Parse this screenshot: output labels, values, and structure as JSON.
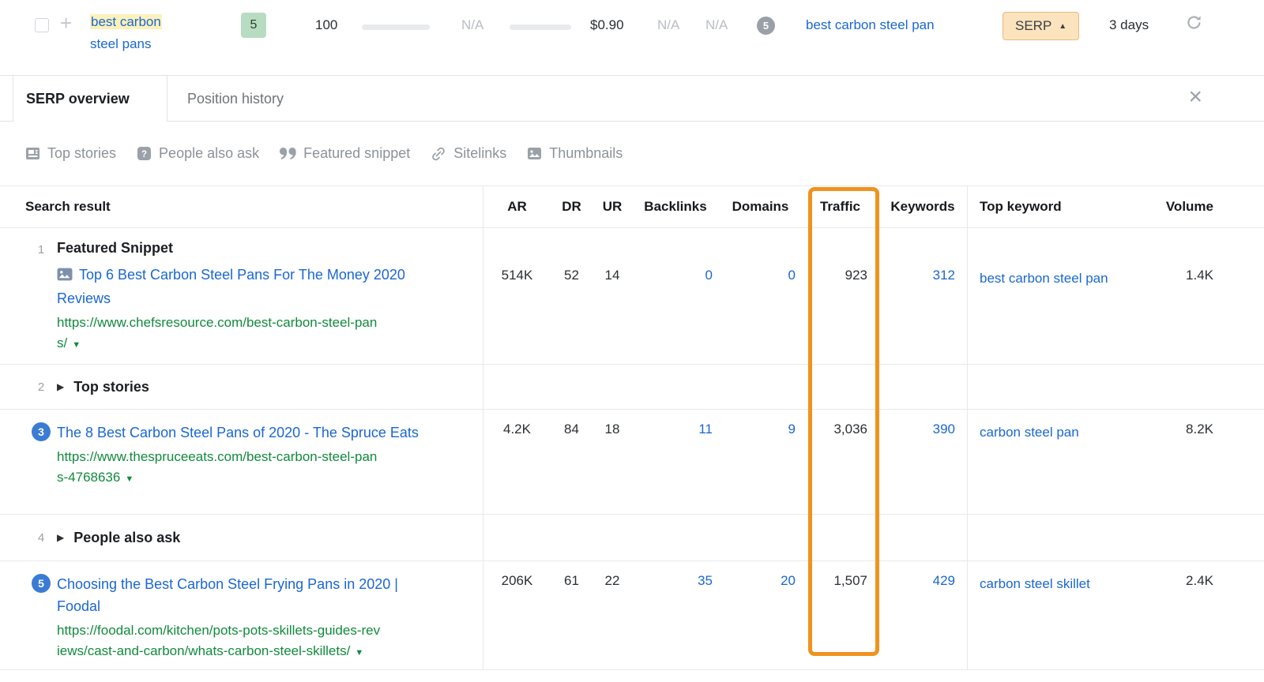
{
  "colors": {
    "link_blue": "#1a67d2",
    "url_green": "#118a3c",
    "hl_orange": "#f0921e",
    "kw_hl": "#fcf1bb",
    "kd_bg": "#b8dcc2",
    "kd_text": "#26402e",
    "serp_bg": "#fbe3bd",
    "serp_border": "#e9ba80",
    "gray_circle": "#99a0a7",
    "pos_blue": "#3a7cd5"
  },
  "glyphs": {
    "plus": "+",
    "close": "×",
    "caret_up": "▲",
    "caret_down": "▼",
    "expand_caret": "▶"
  },
  "keyword_row": {
    "keyword_highlight": "best carbon",
    "keyword_rest": " steel pans",
    "kd": "5",
    "volume": "100",
    "na1": "N/A",
    "cpc": "$0.90",
    "na2": "N/A",
    "na3": "N/A",
    "serp_features_count": "5",
    "top_keyword": "best carbon steel pan",
    "serp_button_label": "SERP",
    "updated": "3 days"
  },
  "panel": {
    "tabs": [
      {
        "label": "SERP overview"
      },
      {
        "label": "Position history"
      }
    ],
    "filters": [
      {
        "label": "Top stories",
        "icon": "top-stories-icon"
      },
      {
        "label": "People also ask",
        "icon": "people-also-ask-icon"
      },
      {
        "label": "Featured snippet",
        "icon": "featured-snippet-icon"
      },
      {
        "label": "Sitelinks",
        "icon": "sitelinks-icon"
      },
      {
        "label": "Thumbnails",
        "icon": "thumbnails-icon"
      }
    ]
  },
  "table": {
    "columns": [
      "Search result",
      "AR",
      "DR",
      "UR",
      "Backlinks",
      "Domains",
      "Traffic",
      "Keywords",
      "Top keyword",
      "Volume"
    ],
    "rows": [
      {
        "pos": "1",
        "section": "Featured Snippet",
        "title": "Top 6 Best Carbon Steel Pans For The Money 2020 Reviews",
        "url": "https://www.chefsresource.com/best-carbon-steel-pans/",
        "ar": "514K",
        "dr": "52",
        "ur": "14",
        "backlinks": "0",
        "domains": "0",
        "traffic": "923",
        "keywords": "312",
        "top_keyword": "best carbon steel pan",
        "volume": "1.4K"
      },
      {
        "pos": "2",
        "expand_label": "Top stories"
      },
      {
        "pos": "3",
        "title": "The 8 Best Carbon Steel Pans of 2020 - The Spruce Eats",
        "url": "https://www.thespruceeats.com/best-carbon-steel-pans-4768636",
        "ar": "4.2K",
        "dr": "84",
        "ur": "18",
        "backlinks": "11",
        "domains": "9",
        "traffic": "3,036",
        "keywords": "390",
        "top_keyword": "carbon steel pan",
        "volume": "8.2K"
      },
      {
        "pos": "4",
        "expand_label": "People also ask"
      },
      {
        "pos": "5",
        "title": "Choosing the Best Carbon Steel Frying Pans in 2020 | Foodal",
        "url": "https://foodal.com/kitchen/pots-pots-skillets-guides-reviews/cast-and-carbon/whats-carbon-steel-skillets/",
        "ar": "206K",
        "dr": "61",
        "ur": "22",
        "backlinks": "35",
        "domains": "20",
        "traffic": "1,507",
        "keywords": "429",
        "top_keyword": "carbon steel skillet",
        "volume": "2.4K"
      }
    ]
  },
  "annotation": {
    "highlighted_column": "Traffic",
    "color": "#f0921e"
  }
}
